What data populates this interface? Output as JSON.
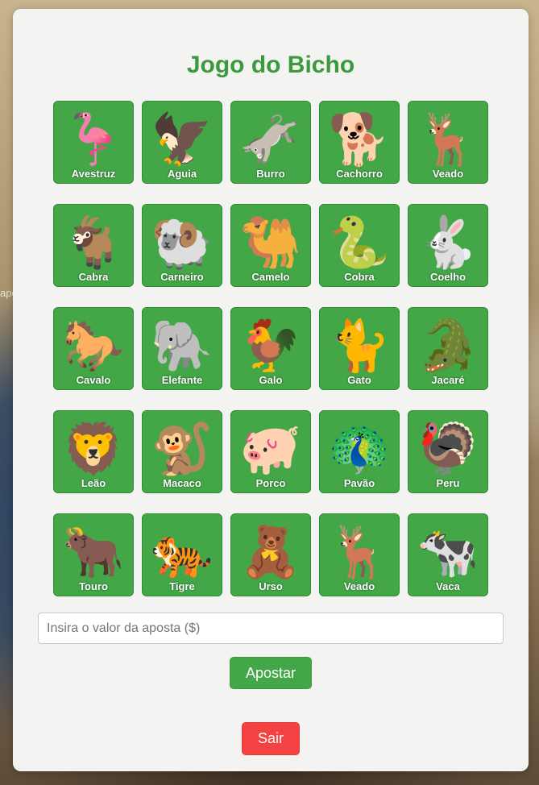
{
  "backdrop": {
    "label": "apelda"
  },
  "panel": {
    "title": "Jogo do Bicho"
  },
  "animals": [
    {
      "name": "Avestruz",
      "icon": "ostrich-icon",
      "glyph": "🦩"
    },
    {
      "name": "Aguia",
      "icon": "eagle-icon",
      "glyph": "🦅"
    },
    {
      "name": "Burro",
      "icon": "donkey-icon",
      "glyph": "🫏"
    },
    {
      "name": "Cachorro",
      "icon": "dog-icon",
      "glyph": "🐕"
    },
    {
      "name": "Veado",
      "icon": "deer-icon",
      "glyph": "🦌"
    },
    {
      "name": "Cabra",
      "icon": "goat-icon",
      "glyph": "🐐"
    },
    {
      "name": "Carneiro",
      "icon": "ram-icon",
      "glyph": "🐏"
    },
    {
      "name": "Camelo",
      "icon": "camel-icon",
      "glyph": "🐫"
    },
    {
      "name": "Cobra",
      "icon": "snake-icon",
      "glyph": "🐍"
    },
    {
      "name": "Coelho",
      "icon": "rabbit-icon",
      "glyph": "🐇"
    },
    {
      "name": "Cavalo",
      "icon": "horse-icon",
      "glyph": "🐎"
    },
    {
      "name": "Elefante",
      "icon": "elephant-icon",
      "glyph": "🐘"
    },
    {
      "name": "Galo",
      "icon": "rooster-icon",
      "glyph": "🐓"
    },
    {
      "name": "Gato",
      "icon": "cat-icon",
      "glyph": "🐈"
    },
    {
      "name": "Jacaré",
      "icon": "alligator-icon",
      "glyph": "🐊"
    },
    {
      "name": "Leão",
      "icon": "lion-icon",
      "glyph": "🦁"
    },
    {
      "name": "Macaco",
      "icon": "monkey-icon",
      "glyph": "🐒"
    },
    {
      "name": "Porco",
      "icon": "pig-icon",
      "glyph": "🐖"
    },
    {
      "name": "Pavão",
      "icon": "peacock-icon",
      "glyph": "🦚"
    },
    {
      "name": "Peru",
      "icon": "turkey-icon",
      "glyph": "🦃"
    },
    {
      "name": "Touro",
      "icon": "bull-icon",
      "glyph": "🐂"
    },
    {
      "name": "Tigre",
      "icon": "tiger-icon",
      "glyph": "🐅"
    },
    {
      "name": "Urso",
      "icon": "bear-icon",
      "glyph": "🧸"
    },
    {
      "name": "Veado",
      "icon": "deer-icon",
      "glyph": "🦌"
    },
    {
      "name": "Vaca",
      "icon": "cow-icon",
      "glyph": "🐄"
    }
  ],
  "bet": {
    "placeholder": "Insira o valor da aposta ($)",
    "value": ""
  },
  "buttons": {
    "bet_label": "Apostar",
    "exit_label": "Sair"
  },
  "colors": {
    "accent": "#43a747",
    "title": "#3c9a3e",
    "danger": "#f44141",
    "panel": "#f3f3f2"
  }
}
